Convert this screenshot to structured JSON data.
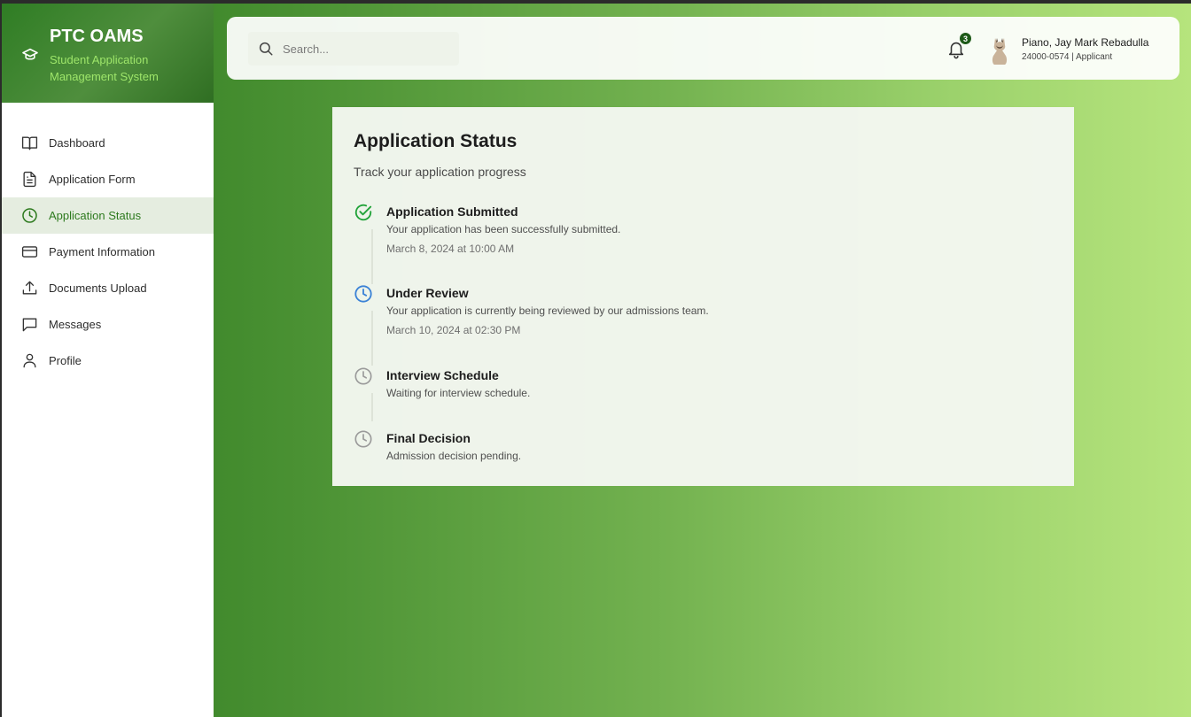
{
  "brand": {
    "title": "PTC OAMS",
    "subtitle": "Student Application Management System",
    "icon": "graduation-cap-icon"
  },
  "sidebar": {
    "items": [
      {
        "label": "Dashboard",
        "icon": "book-open-icon",
        "active": false
      },
      {
        "label": "Application Form",
        "icon": "file-text-icon",
        "active": false
      },
      {
        "label": "Application Status",
        "icon": "clock-icon",
        "active": true
      },
      {
        "label": "Payment Information",
        "icon": "credit-card-icon",
        "active": false
      },
      {
        "label": "Documents Upload",
        "icon": "upload-icon",
        "active": false
      },
      {
        "label": "Messages",
        "icon": "message-square-icon",
        "active": false
      },
      {
        "label": "Profile",
        "icon": "user-icon",
        "active": false
      }
    ]
  },
  "topbar": {
    "search_placeholder": "Search...",
    "search_value": "",
    "notification_count": "3",
    "user_name": "Piano, Jay Mark Rebadulla",
    "user_meta": "24000-0574 | Applicant"
  },
  "status": {
    "title": "Application Status",
    "subtitle": "Track your application progress",
    "steps": [
      {
        "title": "Application Submitted",
        "description": "Your application has been successfully submitted.",
        "date": "March 8, 2024 at 10:00 AM",
        "state": "completed"
      },
      {
        "title": "Under Review",
        "description": "Your application is currently being reviewed by our admissions team.",
        "date": "March 10, 2024 at 02:30 PM",
        "state": "in-progress"
      },
      {
        "title": "Interview Schedule",
        "description": "Waiting for interview schedule.",
        "date": "",
        "state": "pending"
      },
      {
        "title": "Final Decision",
        "description": "Admission decision pending.",
        "date": "",
        "state": "pending"
      }
    ]
  },
  "colors": {
    "accent": "#2d7a1e",
    "completed": "#22a33a",
    "in_progress": "#3b82d6",
    "pending": "#9a9a9a"
  }
}
